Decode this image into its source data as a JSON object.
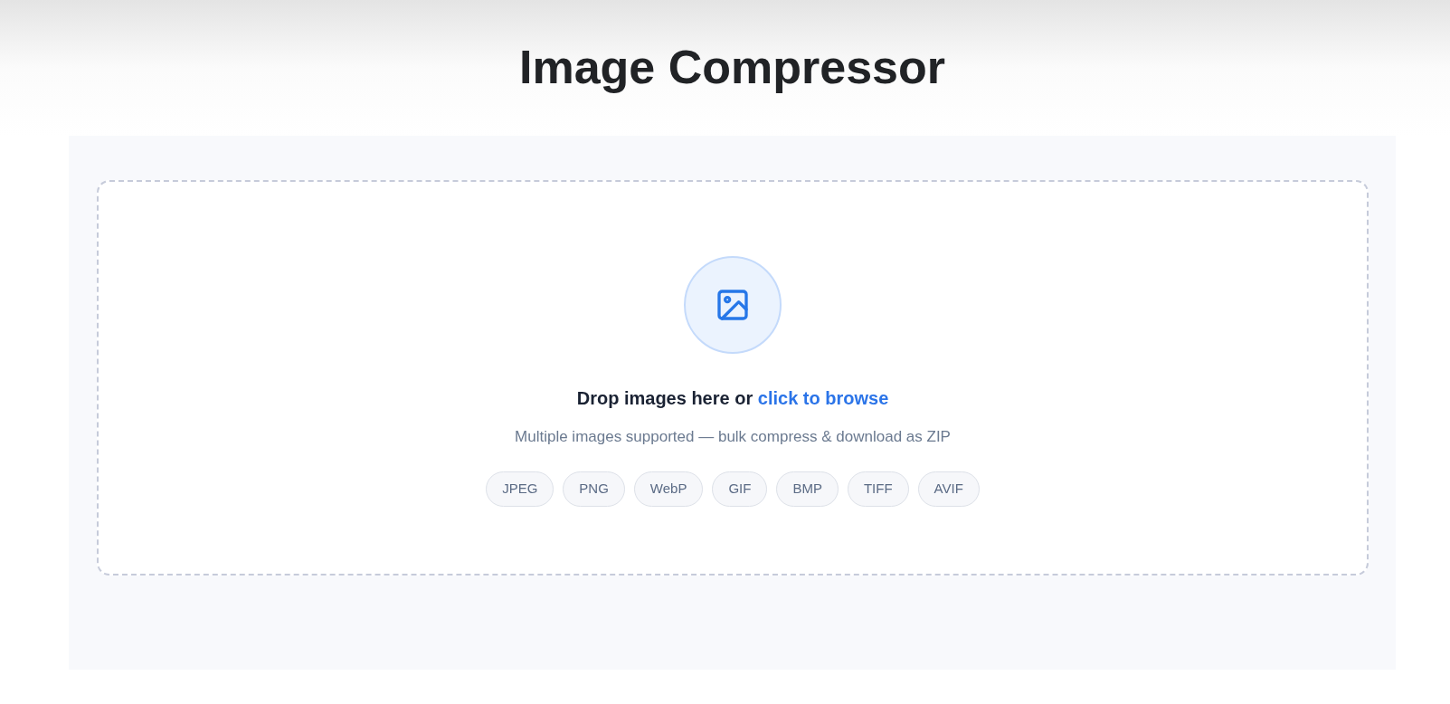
{
  "title": "Image Compressor",
  "upload": {
    "prompt": "Drop images here or",
    "link": "click to browse",
    "note": "Multiple images supported — bulk compress & download as ZIP",
    "formats": [
      "JPEG",
      "PNG",
      "WebP",
      "GIF",
      "BMP",
      "TIFF",
      "AVIF"
    ]
  }
}
